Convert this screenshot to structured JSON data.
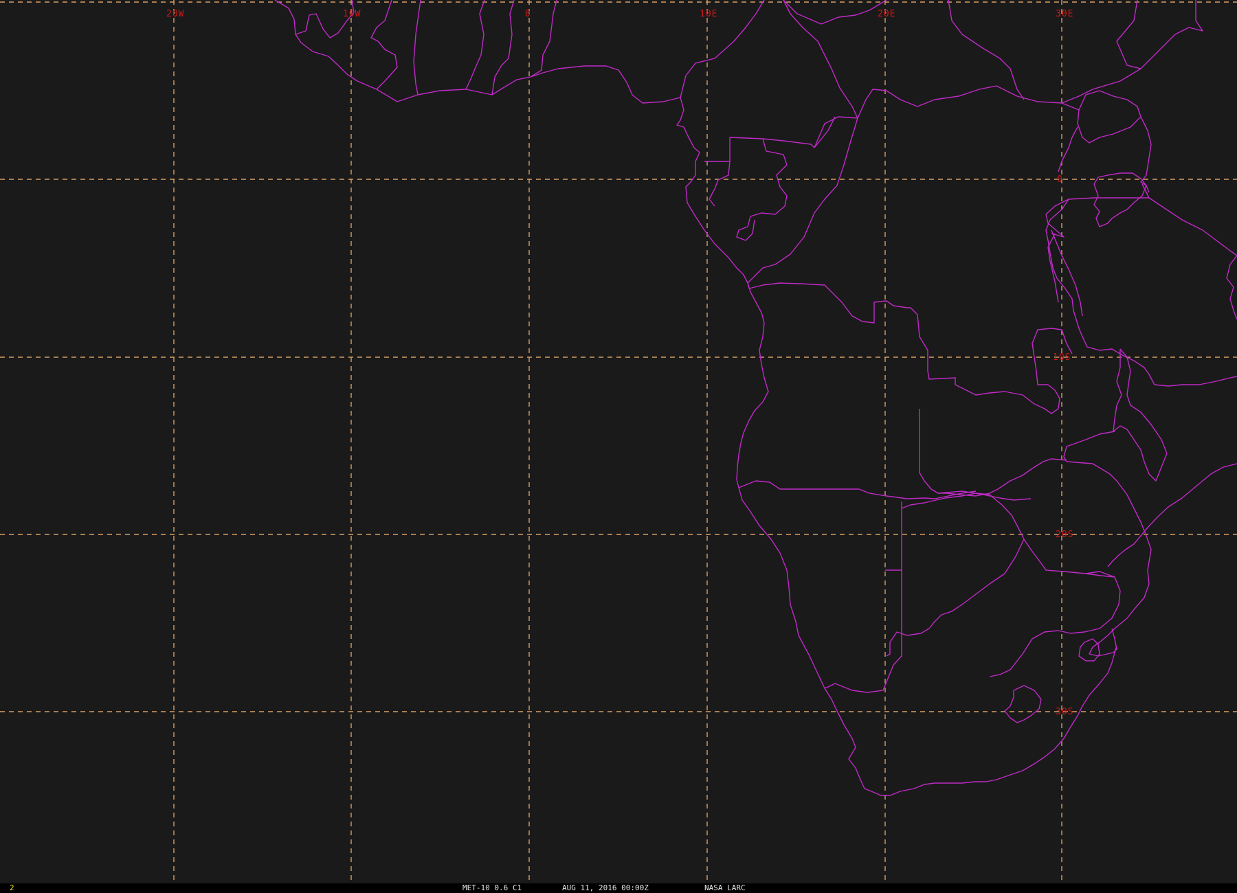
{
  "map": {
    "background_color": "#1a1a1a",
    "border_color": "#c02ac8",
    "grid_color": "#d9a066",
    "label_color": "#d01818",
    "longitude_labels": [
      "20W",
      "10W",
      "0",
      "10E",
      "20E",
      "30E"
    ],
    "latitude_labels": [
      "0",
      "10S",
      "20S",
      "30S"
    ]
  },
  "status_bar": {
    "frame_number": "2",
    "satellite_product": "MET-10 0.6 C1",
    "timestamp": "AUG 11, 2016 00:00Z",
    "credit": "NASA LARC"
  }
}
